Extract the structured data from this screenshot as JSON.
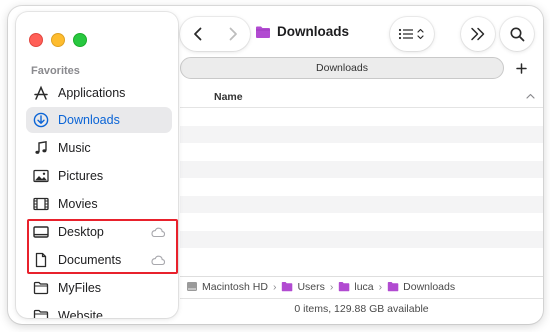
{
  "window": {
    "title": "Downloads",
    "accent": "#0a64d6",
    "highlight_color": "#e8212c",
    "folder_color": "#b14bd1"
  },
  "toolbar": {
    "back_icon": "chevron-left-icon",
    "forward_icon": "chevron-right-icon",
    "view_icon": "list-view-icon",
    "more_icon": "double-chevron-right-icon",
    "search_icon": "search-icon"
  },
  "tabs": [
    {
      "label": "Downloads"
    }
  ],
  "sidebar": {
    "section_title": "Favorites",
    "items": [
      {
        "label": "Applications",
        "icon": "applications-icon"
      },
      {
        "label": "Downloads",
        "icon": "downloads-icon",
        "selected": true
      },
      {
        "label": "Music",
        "icon": "music-icon"
      },
      {
        "label": "Pictures",
        "icon": "pictures-icon"
      },
      {
        "label": "Movies",
        "icon": "movies-icon"
      },
      {
        "label": "Desktop",
        "icon": "desktop-icon",
        "cloud": true
      },
      {
        "label": "Documents",
        "icon": "documents-icon",
        "cloud": true
      },
      {
        "label": "MyFiles",
        "icon": "folder-icon"
      },
      {
        "label": "Website",
        "icon": "folder-icon"
      }
    ]
  },
  "list": {
    "column_name": "Name",
    "items": []
  },
  "pathbar": {
    "crumbs": [
      "Macintosh HD",
      "Users",
      "luca",
      "Downloads"
    ]
  },
  "status": {
    "text": "0 items, 129.88 GB available"
  }
}
